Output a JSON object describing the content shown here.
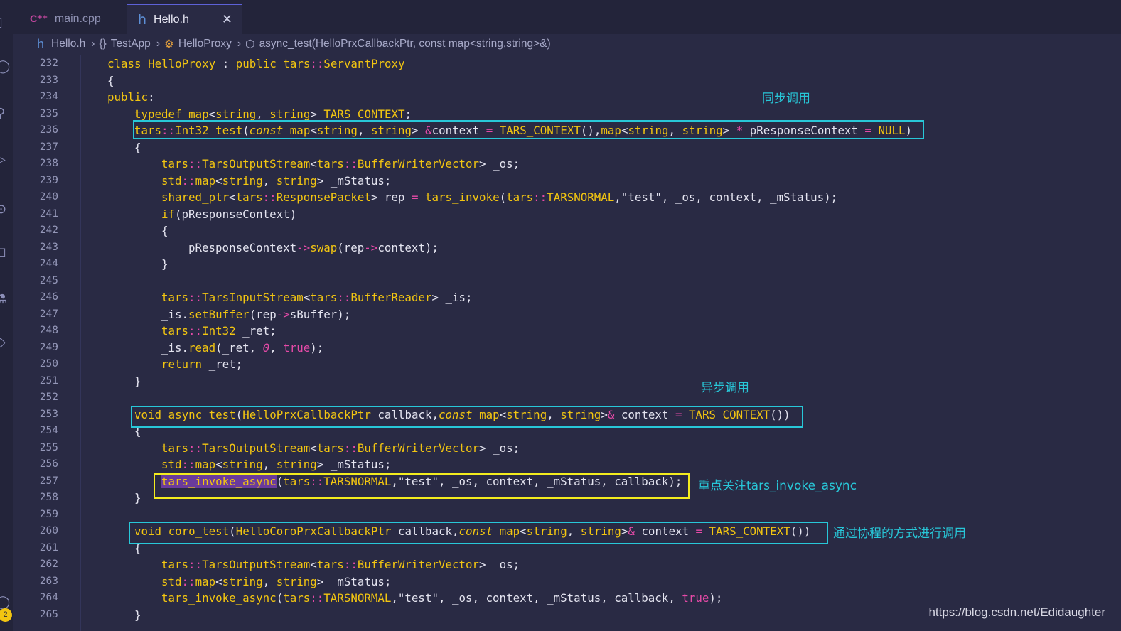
{
  "tabs": [
    {
      "label": "main.cpp",
      "icon": "C++-file-icon",
      "active": false
    },
    {
      "label": "Hello.h",
      "icon": "h-file-icon",
      "active": true
    }
  ],
  "close_glyph": "✕",
  "breadcrumb": [
    "Hello.h",
    "TestApp",
    "HelloProxy",
    "async_test(HelloPrxCallbackPtr, const map<string,string>&)"
  ],
  "notification_count": "2",
  "annotations": {
    "sync": "同步调用",
    "async": "异步调用",
    "focus": "重点关注tars_invoke_async",
    "coro": "通过协程的方式进行调用"
  },
  "watermark": "https://blog.csdn.net/Edidaughter",
  "colors": {
    "accent": "#F2C511",
    "box_cyan": "#28C7D8",
    "box_yellow": "#F3EC1E",
    "background": "#292A44"
  },
  "code_lines": [
    {
      "n": "232",
      "indent": 1,
      "tokens": [
        [
          "kw",
          "class "
        ],
        [
          "ty",
          "HelloProxy"
        ],
        [
          "id",
          " : "
        ],
        [
          "kw",
          "public "
        ],
        [
          "ns",
          "tars"
        ],
        [
          "op",
          "::"
        ],
        [
          "ty",
          "ServantProxy"
        ]
      ]
    },
    {
      "n": "233",
      "indent": 1,
      "tokens": [
        [
          "id",
          "{"
        ]
      ]
    },
    {
      "n": "234",
      "indent": 1,
      "tokens": [
        [
          "kw",
          "public"
        ],
        [
          "id",
          ":"
        ]
      ]
    },
    {
      "n": "235",
      "indent": 2,
      "tokens": [
        [
          "kw",
          "typedef "
        ],
        [
          "ty",
          "map"
        ],
        [
          "id",
          "<"
        ],
        [
          "ty",
          "string"
        ],
        [
          "id",
          ", "
        ],
        [
          "ty",
          "string"
        ],
        [
          "id",
          "> "
        ],
        [
          "ty",
          "TARS_CONTEXT"
        ],
        [
          "id",
          ";"
        ]
      ]
    },
    {
      "n": "236",
      "indent": 2,
      "tokens": [
        [
          "ns",
          "tars"
        ],
        [
          "op",
          "::"
        ],
        [
          "ty",
          "Int32"
        ],
        [
          "id",
          " "
        ],
        [
          "fn",
          "test"
        ],
        [
          "id",
          "("
        ],
        [
          "it",
          "const"
        ],
        [
          "id",
          " "
        ],
        [
          "ty",
          "map"
        ],
        [
          "id",
          "<"
        ],
        [
          "ty",
          "string"
        ],
        [
          "id",
          ", "
        ],
        [
          "ty",
          "string"
        ],
        [
          "id",
          "> "
        ],
        [
          "op",
          "&"
        ],
        [
          "id",
          "context "
        ],
        [
          "op",
          "="
        ],
        [
          "id",
          " "
        ],
        [
          "ty",
          "TARS_CONTEXT"
        ],
        [
          "id",
          "(),"
        ],
        [
          "ty",
          "map"
        ],
        [
          "id",
          "<"
        ],
        [
          "ty",
          "string"
        ],
        [
          "id",
          ", "
        ],
        [
          "ty",
          "string"
        ],
        [
          "id",
          "> "
        ],
        [
          "op",
          "*"
        ],
        [
          "id",
          " pResponseContext "
        ],
        [
          "op",
          "="
        ],
        [
          "id",
          " "
        ],
        [
          "ty",
          "NULL"
        ],
        [
          "id",
          ")"
        ]
      ]
    },
    {
      "n": "237",
      "indent": 2,
      "tokens": [
        [
          "id",
          "{"
        ]
      ]
    },
    {
      "n": "238",
      "indent": 3,
      "tokens": [
        [
          "ns",
          "tars"
        ],
        [
          "op",
          "::"
        ],
        [
          "ty",
          "TarsOutputStream"
        ],
        [
          "id",
          "<"
        ],
        [
          "ns",
          "tars"
        ],
        [
          "op",
          "::"
        ],
        [
          "ty",
          "BufferWriterVector"
        ],
        [
          "id",
          "> _os;"
        ]
      ]
    },
    {
      "n": "239",
      "indent": 3,
      "tokens": [
        [
          "ns",
          "std"
        ],
        [
          "op",
          "::"
        ],
        [
          "ty",
          "map"
        ],
        [
          "id",
          "<"
        ],
        [
          "ty",
          "string"
        ],
        [
          "id",
          ", "
        ],
        [
          "ty",
          "string"
        ],
        [
          "id",
          "> _mStatus;"
        ]
      ]
    },
    {
      "n": "240",
      "indent": 3,
      "tokens": [
        [
          "ty",
          "shared_ptr"
        ],
        [
          "id",
          "<"
        ],
        [
          "ns",
          "tars"
        ],
        [
          "op",
          "::"
        ],
        [
          "ty",
          "ResponsePacket"
        ],
        [
          "id",
          "> rep "
        ],
        [
          "op",
          "="
        ],
        [
          "id",
          " "
        ],
        [
          "fn",
          "tars_invoke"
        ],
        [
          "id",
          "("
        ],
        [
          "ns",
          "tars"
        ],
        [
          "op",
          "::"
        ],
        [
          "ty",
          "TARSNORMAL"
        ],
        [
          "id",
          ",\"test\", _os, context, _mStatus);"
        ]
      ]
    },
    {
      "n": "241",
      "indent": 3,
      "tokens": [
        [
          "kw",
          "if"
        ],
        [
          "id",
          "(pResponseContext)"
        ]
      ]
    },
    {
      "n": "242",
      "indent": 3,
      "tokens": [
        [
          "id",
          "{"
        ]
      ]
    },
    {
      "n": "243",
      "indent": 4,
      "tokens": [
        [
          "id",
          "pResponseContext"
        ],
        [
          "op",
          "->"
        ],
        [
          "fn",
          "swap"
        ],
        [
          "id",
          "(rep"
        ],
        [
          "op",
          "->"
        ],
        [
          "id",
          "context);"
        ]
      ]
    },
    {
      "n": "244",
      "indent": 3,
      "tokens": [
        [
          "id",
          "}"
        ]
      ]
    },
    {
      "n": "245",
      "indent": 0,
      "tokens": []
    },
    {
      "n": "246",
      "indent": 3,
      "tokens": [
        [
          "ns",
          "tars"
        ],
        [
          "op",
          "::"
        ],
        [
          "ty",
          "TarsInputStream"
        ],
        [
          "id",
          "<"
        ],
        [
          "ns",
          "tars"
        ],
        [
          "op",
          "::"
        ],
        [
          "ty",
          "BufferReader"
        ],
        [
          "id",
          "> _is;"
        ]
      ]
    },
    {
      "n": "247",
      "indent": 3,
      "tokens": [
        [
          "id",
          "_is."
        ],
        [
          "fn",
          "setBuffer"
        ],
        [
          "id",
          "(rep"
        ],
        [
          "op",
          "->"
        ],
        [
          "id",
          "sBuffer);"
        ]
      ]
    },
    {
      "n": "248",
      "indent": 3,
      "tokens": [
        [
          "ns",
          "tars"
        ],
        [
          "op",
          "::"
        ],
        [
          "ty",
          "Int32"
        ],
        [
          "id",
          " _ret;"
        ]
      ]
    },
    {
      "n": "249",
      "indent": 3,
      "tokens": [
        [
          "id",
          "_is."
        ],
        [
          "fn",
          "read"
        ],
        [
          "id",
          "(_ret, "
        ],
        [
          "num",
          "0"
        ],
        [
          "id",
          ", "
        ],
        [
          "lit",
          "true"
        ],
        [
          "id",
          ");"
        ]
      ]
    },
    {
      "n": "250",
      "indent": 3,
      "tokens": [
        [
          "kw",
          "return"
        ],
        [
          "id",
          " _ret;"
        ]
      ]
    },
    {
      "n": "251",
      "indent": 2,
      "tokens": [
        [
          "id",
          "}"
        ]
      ]
    },
    {
      "n": "252",
      "indent": 0,
      "tokens": []
    },
    {
      "n": "253",
      "indent": 2,
      "tokens": [
        [
          "kw",
          "void "
        ],
        [
          "fn",
          "async_test"
        ],
        [
          "id",
          "("
        ],
        [
          "ty",
          "HelloPrxCallbackPtr"
        ],
        [
          "id",
          " callback,"
        ],
        [
          "it",
          "const"
        ],
        [
          "id",
          " "
        ],
        [
          "ty",
          "map"
        ],
        [
          "id",
          "<"
        ],
        [
          "ty",
          "string"
        ],
        [
          "id",
          ", "
        ],
        [
          "ty",
          "string"
        ],
        [
          "id",
          ">"
        ],
        [
          "op",
          "&"
        ],
        [
          "id",
          " context "
        ],
        [
          "op",
          "="
        ],
        [
          "id",
          " "
        ],
        [
          "ty",
          "TARS_CONTEXT"
        ],
        [
          "id",
          "())"
        ]
      ]
    },
    {
      "n": "254",
      "indent": 2,
      "tokens": [
        [
          "id",
          "{"
        ]
      ]
    },
    {
      "n": "255",
      "indent": 3,
      "tokens": [
        [
          "ns",
          "tars"
        ],
        [
          "op",
          "::"
        ],
        [
          "ty",
          "TarsOutputStream"
        ],
        [
          "id",
          "<"
        ],
        [
          "ns",
          "tars"
        ],
        [
          "op",
          "::"
        ],
        [
          "ty",
          "BufferWriterVector"
        ],
        [
          "id",
          "> _os;"
        ]
      ]
    },
    {
      "n": "256",
      "indent": 3,
      "tokens": [
        [
          "ns",
          "std"
        ],
        [
          "op",
          "::"
        ],
        [
          "ty",
          "map"
        ],
        [
          "id",
          "<"
        ],
        [
          "ty",
          "string"
        ],
        [
          "id",
          ", "
        ],
        [
          "ty",
          "string"
        ],
        [
          "id",
          "> _mStatus;"
        ]
      ]
    },
    {
      "n": "257",
      "indent": 3,
      "tokens": [
        [
          "hl",
          "tars_invoke_async"
        ],
        [
          "id",
          "("
        ],
        [
          "ns",
          "tars"
        ],
        [
          "op",
          "::"
        ],
        [
          "ty",
          "TARSNORMAL"
        ],
        [
          "id",
          ",\"test\", _os, context, _mStatus, callback);"
        ]
      ]
    },
    {
      "n": "258",
      "indent": 2,
      "tokens": [
        [
          "id",
          "}"
        ]
      ]
    },
    {
      "n": "259",
      "indent": 0,
      "tokens": []
    },
    {
      "n": "260",
      "indent": 2,
      "tokens": [
        [
          "kw",
          "void "
        ],
        [
          "fn",
          "coro_test"
        ],
        [
          "id",
          "("
        ],
        [
          "ty",
          "HelloCoroPrxCallbackPtr"
        ],
        [
          "id",
          " callback,"
        ],
        [
          "it",
          "const"
        ],
        [
          "id",
          " "
        ],
        [
          "ty",
          "map"
        ],
        [
          "id",
          "<"
        ],
        [
          "ty",
          "string"
        ],
        [
          "id",
          ", "
        ],
        [
          "ty",
          "string"
        ],
        [
          "id",
          ">"
        ],
        [
          "op",
          "&"
        ],
        [
          "id",
          " context "
        ],
        [
          "op",
          "="
        ],
        [
          "id",
          " "
        ],
        [
          "ty",
          "TARS_CONTEXT"
        ],
        [
          "id",
          "())"
        ]
      ]
    },
    {
      "n": "261",
      "indent": 2,
      "tokens": [
        [
          "id",
          "{"
        ]
      ]
    },
    {
      "n": "262",
      "indent": 3,
      "tokens": [
        [
          "ns",
          "tars"
        ],
        [
          "op",
          "::"
        ],
        [
          "ty",
          "TarsOutputStream"
        ],
        [
          "id",
          "<"
        ],
        [
          "ns",
          "tars"
        ],
        [
          "op",
          "::"
        ],
        [
          "ty",
          "BufferWriterVector"
        ],
        [
          "id",
          "> _os;"
        ]
      ]
    },
    {
      "n": "263",
      "indent": 3,
      "tokens": [
        [
          "ns",
          "std"
        ],
        [
          "op",
          "::"
        ],
        [
          "ty",
          "map"
        ],
        [
          "id",
          "<"
        ],
        [
          "ty",
          "string"
        ],
        [
          "id",
          ", "
        ],
        [
          "ty",
          "string"
        ],
        [
          "id",
          "> _mStatus;"
        ]
      ]
    },
    {
      "n": "264",
      "indent": 3,
      "tokens": [
        [
          "fn",
          "tars_invoke_async"
        ],
        [
          "id",
          "("
        ],
        [
          "ns",
          "tars"
        ],
        [
          "op",
          "::"
        ],
        [
          "ty",
          "TARSNORMAL"
        ],
        [
          "id",
          ",\"test\", _os, context, _mStatus, callback, "
        ],
        [
          "lit",
          "true"
        ],
        [
          "id",
          ");"
        ]
      ]
    },
    {
      "n": "265",
      "indent": 2,
      "tokens": [
        [
          "id",
          "}"
        ]
      ]
    }
  ]
}
